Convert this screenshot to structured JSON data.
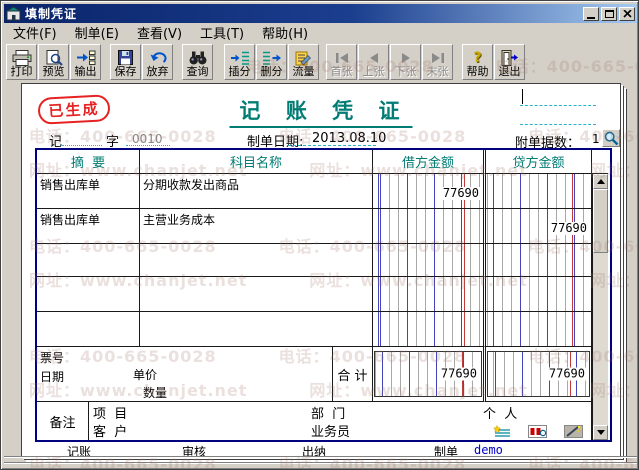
{
  "window": {
    "title": "填制凭证"
  },
  "menu": {
    "items": [
      {
        "label": "文件(F)"
      },
      {
        "label": "制单(E)"
      },
      {
        "label": "查看(V)"
      },
      {
        "label": "工具(T)"
      },
      {
        "label": "帮助(H)"
      }
    ]
  },
  "toolbar": {
    "buttons": [
      {
        "label": "打印",
        "icon": "printer"
      },
      {
        "label": "预览",
        "icon": "print-preview"
      },
      {
        "label": "输出",
        "icon": "export"
      },
      {
        "label": "保存",
        "icon": "save-floppy"
      },
      {
        "label": "放弃",
        "icon": "undo"
      },
      {
        "label": "查询",
        "icon": "binoculars"
      },
      {
        "label": "插分",
        "icon": "insert-entry-line"
      },
      {
        "label": "删分",
        "icon": "delete-entry-line"
      },
      {
        "label": "流量",
        "icon": "cash-flow"
      },
      {
        "label": "首张",
        "icon": "first-page",
        "disabled": true
      },
      {
        "label": "上张",
        "icon": "prev-page",
        "disabled": true
      },
      {
        "label": "下张",
        "icon": "next-page",
        "disabled": true
      },
      {
        "label": "末张",
        "icon": "last-page",
        "disabled": true
      },
      {
        "label": "帮助",
        "icon": "help-question"
      },
      {
        "label": "退出",
        "icon": "exit-door"
      }
    ]
  },
  "icons": {
    "help_glyph": "?"
  },
  "voucher": {
    "stamp": "已生成",
    "title": "记 账 凭 证",
    "word_left": "记",
    "word_right": "字",
    "word_no": "0010",
    "date_label": "制单日期:",
    "date_value": "2013.08.10",
    "attach_label": "附单据数：",
    "attach_count": "1",
    "table": {
      "header": {
        "summary": "摘  要",
        "account": "科目名称",
        "debit": "借方金额",
        "credit": "贷方金额"
      },
      "rows": [
        {
          "summary": "销售出库单",
          "account": "分期收款发出商品",
          "debit": "77690",
          "credit": ""
        },
        {
          "summary": "销售出库单",
          "account": "主营业务成本",
          "debit": "",
          "credit": "77690"
        },
        {
          "summary": "",
          "account": "",
          "debit": "",
          "credit": ""
        },
        {
          "summary": "",
          "account": "",
          "debit": "",
          "credit": ""
        },
        {
          "summary": "",
          "account": "",
          "debit": "",
          "credit": ""
        }
      ],
      "footer": {
        "ticket_label": "票号",
        "date_label": "日期",
        "price_label": "单价",
        "qty_label": "数量",
        "total_label": "合 计",
        "total_debit": "77690",
        "total_credit": "77690"
      },
      "remark": {
        "label": "备注",
        "project": "项  目",
        "customer": "客  户",
        "department": "部  门",
        "salesman": "业务员",
        "person": "个  人"
      }
    },
    "signatures": {
      "bookkeeping": "记账",
      "audit": "审核",
      "cashier": "出纳",
      "preparer_label": "制单",
      "preparer_value": "demo"
    }
  },
  "watermark": {
    "phone": "电话：400-665-0028",
    "site": "网址：www.chanjet.net"
  },
  "colors": {
    "teal_accent": "#007c74",
    "table_border_navy": "#000080",
    "stamp_red": "#e62222",
    "ledger_blue": "#4444b8",
    "ledger_red": "#c33838",
    "demo_blue": "#0000cc",
    "titlebar_left": "#0a246a",
    "titlebar_right": "#a6caf0",
    "chrome_gray": "#d4d0c8"
  }
}
